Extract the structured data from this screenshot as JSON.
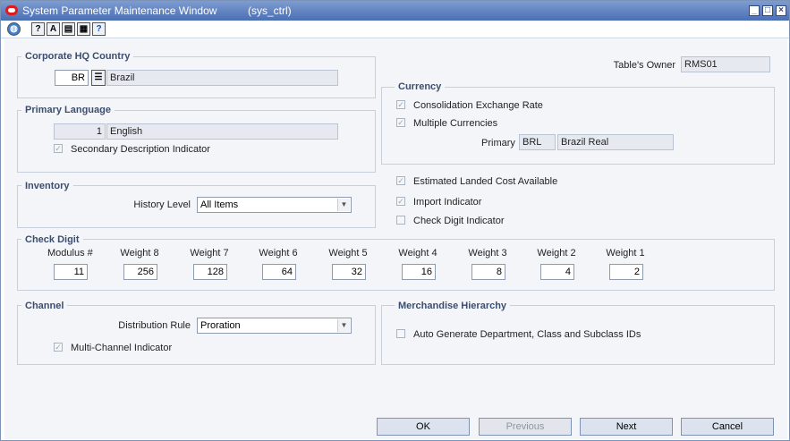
{
  "window": {
    "title": "System Parameter Maintenance Window",
    "subtitle": "(sys_ctrl)",
    "controls": [
      "minimize",
      "maximize",
      "close"
    ]
  },
  "toolbar": {
    "icons": [
      "globe-icon",
      "help-cursor-icon",
      "font-icon",
      "clipboard-icon",
      "print-icon",
      "question-icon"
    ]
  },
  "corporate_hq": {
    "title": "Corporate HQ Country",
    "code": "BR",
    "name": "Brazil"
  },
  "tables_owner": {
    "label": "Table's Owner",
    "value": "RMS01"
  },
  "currency": {
    "title": "Currency",
    "consolidation_label": "Consolidation Exchange Rate",
    "consolidation_checked": true,
    "multiple_label": "Multiple Currencies",
    "multiple_checked": true,
    "primary_label": "Primary",
    "primary_code": "BRL",
    "primary_name": "Brazil Real"
  },
  "primary_language": {
    "title": "Primary Language",
    "code": "1",
    "name": "English",
    "secondary_label": "Secondary Description Indicator",
    "secondary_checked": true
  },
  "inventory": {
    "title": "Inventory",
    "history_label": "History Level",
    "history_value": "All Items"
  },
  "flags": {
    "estimated_label": "Estimated Landed Cost Available",
    "estimated_checked": true,
    "import_label": "Import Indicator",
    "import_checked": true,
    "check_digit_label": "Check Digit Indicator",
    "check_digit_checked": false
  },
  "check_digit": {
    "title": "Check Digit",
    "columns": [
      {
        "label": "Modulus #",
        "value": "11"
      },
      {
        "label": "Weight 8",
        "value": "256"
      },
      {
        "label": "Weight 7",
        "value": "128"
      },
      {
        "label": "Weight 6",
        "value": "64"
      },
      {
        "label": "Weight 5",
        "value": "32"
      },
      {
        "label": "Weight 4",
        "value": "16"
      },
      {
        "label": "Weight 3",
        "value": "8"
      },
      {
        "label": "Weight 2",
        "value": "4"
      },
      {
        "label": "Weight 1",
        "value": "2"
      }
    ]
  },
  "channel": {
    "title": "Channel",
    "distribution_label": "Distribution Rule",
    "distribution_value": "Proration",
    "multi_label": "Multi-Channel Indicator",
    "multi_checked": true
  },
  "merch_hierarchy": {
    "title": "Merchandise Hierarchy",
    "auto_label": "Auto Generate Department, Class and Subclass IDs",
    "auto_checked": false
  },
  "buttons": {
    "ok": "OK",
    "previous": "Previous",
    "next": "Next",
    "cancel": "Cancel"
  }
}
